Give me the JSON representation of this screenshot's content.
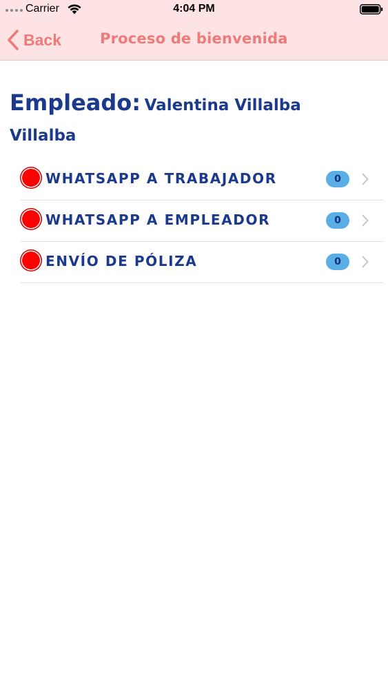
{
  "status_bar": {
    "carrier": "Carrier",
    "time": "4:04 PM",
    "icons": [
      "signal-dots-icon",
      "wifi-icon",
      "battery-icon"
    ]
  },
  "nav": {
    "back_label": "Back",
    "title": "Proceso de bienvenida",
    "accent_color": "#ef7a7a",
    "background_color": "#fde3e3"
  },
  "employee": {
    "label": "Empleado:",
    "name": "Valentina Villalba Villalba",
    "text_color": "#1b3a8c"
  },
  "tasks": [
    {
      "label": "WHATSAPP A TRABAJADOR",
      "count": "0",
      "status_color": "#ff0000"
    },
    {
      "label": "WHATSAPP A EMPLEADOR",
      "count": "0",
      "status_color": "#ff0000"
    },
    {
      "label": "ENVÍO DE PÓLIZA",
      "count": "0",
      "status_color": "#ff0000"
    }
  ],
  "badge_color": "#5aaee6"
}
